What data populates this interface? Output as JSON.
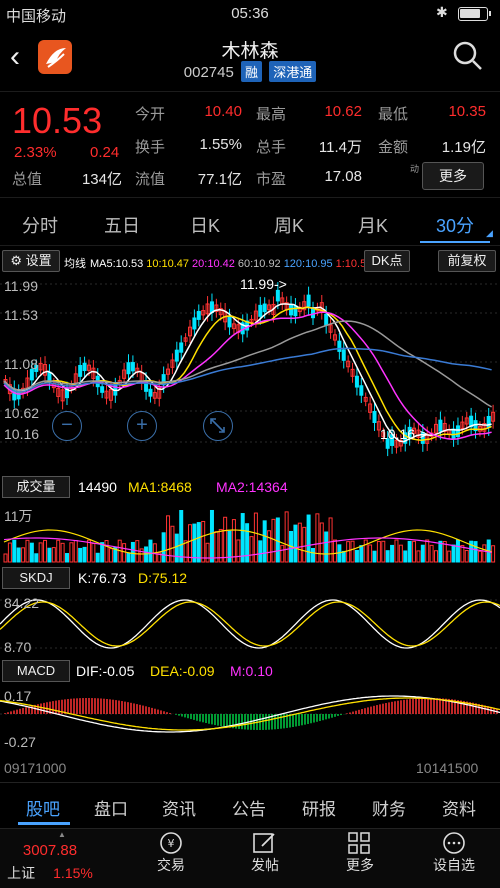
{
  "status_bar": {
    "carrier": "中国移动",
    "time": "05:36"
  },
  "header": {
    "title": "木林森",
    "code": "002745",
    "tags": [
      "融",
      "深港通"
    ]
  },
  "quote": {
    "price": "10.53",
    "change_pct": "2.33%",
    "change": "0.24",
    "fields": [
      {
        "label": "今开",
        "value": "10.40",
        "color": "red"
      },
      {
        "label": "最高",
        "value": "10.62",
        "color": "red"
      },
      {
        "label": "最低",
        "value": "10.35",
        "color": "red"
      },
      {
        "label": "换手",
        "value": "1.55%",
        "color": "white"
      },
      {
        "label": "总手",
        "value": "11.4万",
        "color": "white"
      },
      {
        "label": "金额",
        "value": "1.19亿",
        "color": "white"
      },
      {
        "label": "总值",
        "value": "134亿",
        "color": "white"
      },
      {
        "label": "流值",
        "value": "77.1亿",
        "color": "white"
      },
      {
        "label": "市盈",
        "value": "17.08",
        "color": "white",
        "sup": "动"
      }
    ],
    "more_label": "更多"
  },
  "period_tabs": [
    "分时",
    "五日",
    "日K",
    "周K",
    "月K",
    "30分"
  ],
  "active_tab": "30分",
  "chart_toolbar": {
    "settings_label": "设置",
    "ma_title": "均线",
    "ma": [
      {
        "text": "MA5:10.53",
        "color": "#ffffff"
      },
      {
        "text": "10:10.47",
        "color": "#ffe000"
      },
      {
        "text": "20:10.42",
        "color": "#ff33ff"
      },
      {
        "text": "60:10.92",
        "color": "#bdbdbd"
      },
      {
        "text": "120:10.95",
        "color": "#4aa3ff"
      },
      {
        "text": "1:10.5",
        "color": "#ff3333"
      }
    ],
    "dk_label": "DK点",
    "fq_label": "前复权"
  },
  "price_axis": [
    "11.99",
    "11.53",
    "11.08",
    "10.62",
    "10.16"
  ],
  "high_annotation": "11.99->",
  "low_annotation": "10.16->",
  "volume": {
    "button": "成交量",
    "vol": "14490",
    "ma1": "MA1:8468",
    "ma2": "MA2:14364",
    "axis": "11万"
  },
  "skdj": {
    "button": "SKDJ",
    "k": "K:76.73",
    "d": "D:75.12",
    "axis_top": "84.22",
    "axis_bot": "8.70"
  },
  "macd": {
    "button": "MACD",
    "dif": "DIF:-0.05",
    "dea": "DEA:-0.09",
    "m": "M:0.10",
    "axis_top": "0.17",
    "axis_bot": "-0.27"
  },
  "time_axis": {
    "start": "09171000",
    "end": "10141500"
  },
  "bottom_tabs": [
    "股吧",
    "盘口",
    "资讯",
    "公告",
    "研报",
    "财务",
    "资料"
  ],
  "index": {
    "value": "3007.88",
    "name": "上证",
    "pct": "1.15%"
  },
  "dock": [
    "交易",
    "发帖",
    "更多",
    "设自选"
  ]
}
